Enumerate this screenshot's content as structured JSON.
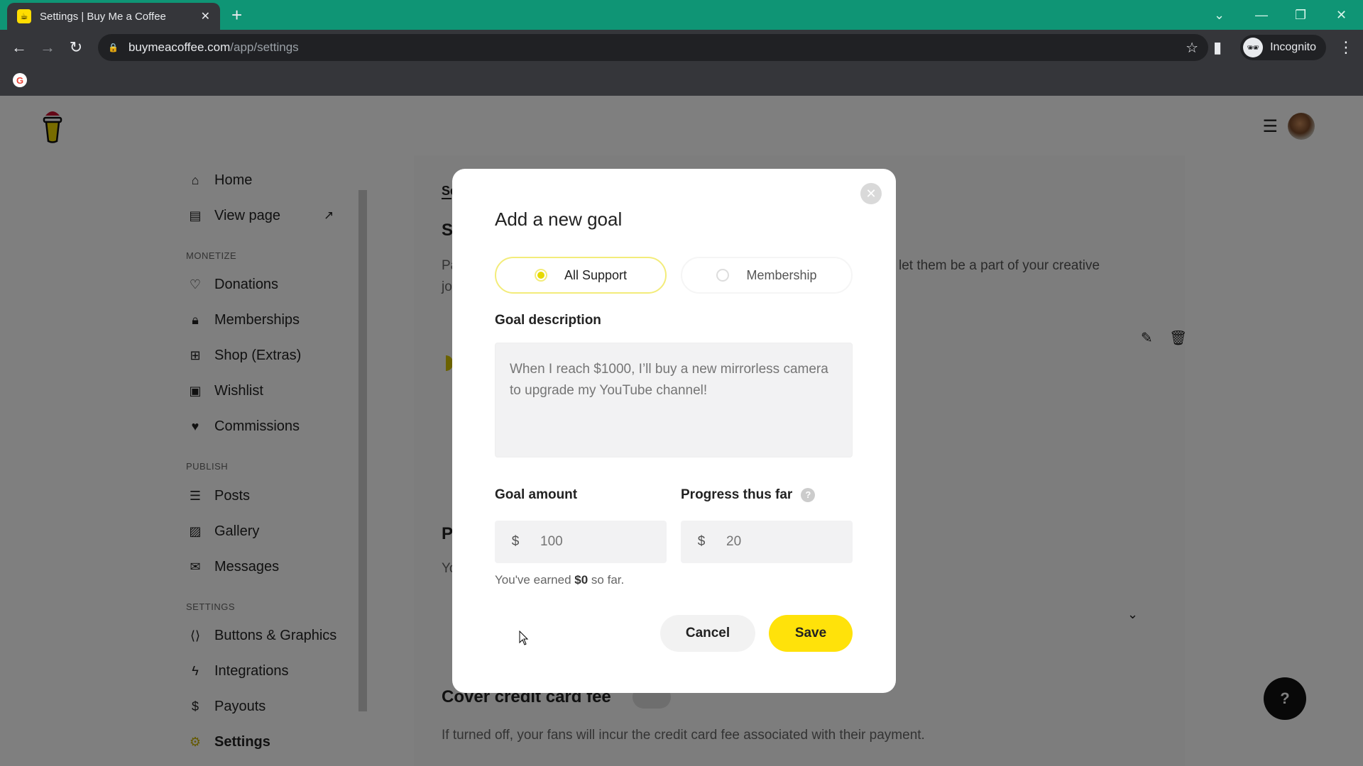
{
  "browser": {
    "tab_title": "Settings | Buy Me a Coffee",
    "url_domain": "buymeacoffee.com",
    "url_path": "/app/settings",
    "profile_label": "Incognito",
    "accent_color": "#0f9575"
  },
  "sidebar": {
    "top_items": [
      {
        "label": "Home",
        "icon": "home-icon"
      },
      {
        "label": "View page",
        "icon": "layout-icon"
      }
    ],
    "sections": [
      {
        "heading": "MONETIZE",
        "items": [
          {
            "label": "Donations",
            "icon": "heart-icon"
          },
          {
            "label": "Memberships",
            "icon": "lock-icon"
          },
          {
            "label": "Shop (Extras)",
            "icon": "gift-icon"
          },
          {
            "label": "Wishlist",
            "icon": "wishlist-icon"
          },
          {
            "label": "Commissions",
            "icon": "handshake-icon"
          }
        ]
      },
      {
        "heading": "PUBLISH",
        "items": [
          {
            "label": "Posts",
            "icon": "posts-icon"
          },
          {
            "label": "Gallery",
            "icon": "image-icon"
          },
          {
            "label": "Messages",
            "icon": "mail-icon"
          }
        ]
      },
      {
        "heading": "SETTINGS",
        "items": [
          {
            "label": "Buttons & Graphics",
            "icon": "code-icon"
          },
          {
            "label": "Integrations",
            "icon": "bolt-icon"
          },
          {
            "label": "Payouts",
            "icon": "dollar-icon"
          },
          {
            "label": "Settings",
            "icon": "gear-icon",
            "active": true
          }
        ]
      }
    ]
  },
  "background": {
    "tab_fragment": "Se",
    "section_title_fragment": "S",
    "desc_fragment_left_1": "Pa",
    "desc_fragment_left_2": "jo",
    "desc_fragment_right": "let them be a part of your creative",
    "section2_title_fragment": "P",
    "section2_desc_fragment": "Yo",
    "cover_fee_title": "Cover credit card fee",
    "cover_fee_desc": "If turned off, your fans will incur the credit card fee associated with their payment.",
    "help_label": "?"
  },
  "modal": {
    "title": "Add a new goal",
    "options": [
      {
        "label": "All Support",
        "selected": true
      },
      {
        "label": "Membership",
        "selected": false
      }
    ],
    "description_label": "Goal description",
    "description_placeholder": "When I reach $1000, I’ll buy a new mirrorless camera to upgrade my YouTube channel!",
    "goal_amount_label": "Goal amount",
    "goal_amount_currency": "$",
    "goal_amount_placeholder": "100",
    "progress_label": "Progress thus far",
    "progress_currency": "$",
    "progress_placeholder": "20",
    "earned_prefix": "You've earned ",
    "earned_amount": "$0",
    "earned_suffix": " so far.",
    "cancel_label": "Cancel",
    "save_label": "Save",
    "save_color": "#ffe20a"
  }
}
